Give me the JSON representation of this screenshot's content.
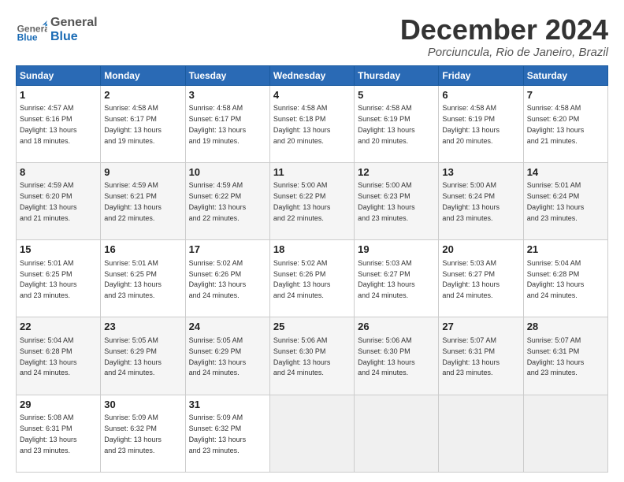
{
  "header": {
    "logo_general": "General",
    "logo_blue": "Blue",
    "month_title": "December 2024",
    "location": "Porciuncula, Rio de Janeiro, Brazil"
  },
  "weekdays": [
    "Sunday",
    "Monday",
    "Tuesday",
    "Wednesday",
    "Thursday",
    "Friday",
    "Saturday"
  ],
  "weeks": [
    [
      {
        "day": "1",
        "sunrise": "4:57 AM",
        "sunset": "6:16 PM",
        "daylight": "13 hours and 18 minutes."
      },
      {
        "day": "2",
        "sunrise": "4:58 AM",
        "sunset": "6:17 PM",
        "daylight": "13 hours and 19 minutes."
      },
      {
        "day": "3",
        "sunrise": "4:58 AM",
        "sunset": "6:17 PM",
        "daylight": "13 hours and 19 minutes."
      },
      {
        "day": "4",
        "sunrise": "4:58 AM",
        "sunset": "6:18 PM",
        "daylight": "13 hours and 20 minutes."
      },
      {
        "day": "5",
        "sunrise": "4:58 AM",
        "sunset": "6:19 PM",
        "daylight": "13 hours and 20 minutes."
      },
      {
        "day": "6",
        "sunrise": "4:58 AM",
        "sunset": "6:19 PM",
        "daylight": "13 hours and 20 minutes."
      },
      {
        "day": "7",
        "sunrise": "4:58 AM",
        "sunset": "6:20 PM",
        "daylight": "13 hours and 21 minutes."
      }
    ],
    [
      {
        "day": "8",
        "sunrise": "4:59 AM",
        "sunset": "6:20 PM",
        "daylight": "13 hours and 21 minutes."
      },
      {
        "day": "9",
        "sunrise": "4:59 AM",
        "sunset": "6:21 PM",
        "daylight": "13 hours and 22 minutes."
      },
      {
        "day": "10",
        "sunrise": "4:59 AM",
        "sunset": "6:22 PM",
        "daylight": "13 hours and 22 minutes."
      },
      {
        "day": "11",
        "sunrise": "5:00 AM",
        "sunset": "6:22 PM",
        "daylight": "13 hours and 22 minutes."
      },
      {
        "day": "12",
        "sunrise": "5:00 AM",
        "sunset": "6:23 PM",
        "daylight": "13 hours and 23 minutes."
      },
      {
        "day": "13",
        "sunrise": "5:00 AM",
        "sunset": "6:24 PM",
        "daylight": "13 hours and 23 minutes."
      },
      {
        "day": "14",
        "sunrise": "5:01 AM",
        "sunset": "6:24 PM",
        "daylight": "13 hours and 23 minutes."
      }
    ],
    [
      {
        "day": "15",
        "sunrise": "5:01 AM",
        "sunset": "6:25 PM",
        "daylight": "13 hours and 23 minutes."
      },
      {
        "day": "16",
        "sunrise": "5:01 AM",
        "sunset": "6:25 PM",
        "daylight": "13 hours and 23 minutes."
      },
      {
        "day": "17",
        "sunrise": "5:02 AM",
        "sunset": "6:26 PM",
        "daylight": "13 hours and 24 minutes."
      },
      {
        "day": "18",
        "sunrise": "5:02 AM",
        "sunset": "6:26 PM",
        "daylight": "13 hours and 24 minutes."
      },
      {
        "day": "19",
        "sunrise": "5:03 AM",
        "sunset": "6:27 PM",
        "daylight": "13 hours and 24 minutes."
      },
      {
        "day": "20",
        "sunrise": "5:03 AM",
        "sunset": "6:27 PM",
        "daylight": "13 hours and 24 minutes."
      },
      {
        "day": "21",
        "sunrise": "5:04 AM",
        "sunset": "6:28 PM",
        "daylight": "13 hours and 24 minutes."
      }
    ],
    [
      {
        "day": "22",
        "sunrise": "5:04 AM",
        "sunset": "6:28 PM",
        "daylight": "13 hours and 24 minutes."
      },
      {
        "day": "23",
        "sunrise": "5:05 AM",
        "sunset": "6:29 PM",
        "daylight": "13 hours and 24 minutes."
      },
      {
        "day": "24",
        "sunrise": "5:05 AM",
        "sunset": "6:29 PM",
        "daylight": "13 hours and 24 minutes."
      },
      {
        "day": "25",
        "sunrise": "5:06 AM",
        "sunset": "6:30 PM",
        "daylight": "13 hours and 24 minutes."
      },
      {
        "day": "26",
        "sunrise": "5:06 AM",
        "sunset": "6:30 PM",
        "daylight": "13 hours and 24 minutes."
      },
      {
        "day": "27",
        "sunrise": "5:07 AM",
        "sunset": "6:31 PM",
        "daylight": "13 hours and 23 minutes."
      },
      {
        "day": "28",
        "sunrise": "5:07 AM",
        "sunset": "6:31 PM",
        "daylight": "13 hours and 23 minutes."
      }
    ],
    [
      {
        "day": "29",
        "sunrise": "5:08 AM",
        "sunset": "6:31 PM",
        "daylight": "13 hours and 23 minutes."
      },
      {
        "day": "30",
        "sunrise": "5:09 AM",
        "sunset": "6:32 PM",
        "daylight": "13 hours and 23 minutes."
      },
      {
        "day": "31",
        "sunrise": "5:09 AM",
        "sunset": "6:32 PM",
        "daylight": "13 hours and 23 minutes."
      },
      null,
      null,
      null,
      null
    ]
  ]
}
